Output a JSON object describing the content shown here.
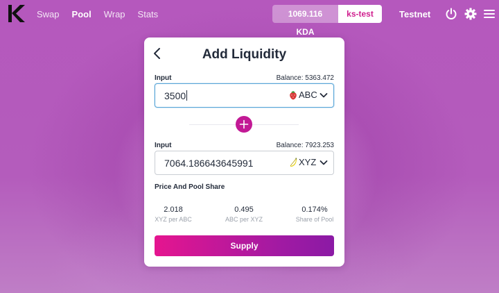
{
  "app": {
    "nav": [
      {
        "label": "Swap"
      },
      {
        "label": "Pool"
      },
      {
        "label": "Wrap"
      },
      {
        "label": "Stats"
      }
    ],
    "active_nav": "Pool",
    "wallet_balance": "1069.116 KDA",
    "account": "ks-test",
    "network": "Testnet"
  },
  "card": {
    "title": "Add Liquidity",
    "input1": {
      "label": "Input",
      "balance": "Balance: 5363.472",
      "value": "3500",
      "token": "ABC",
      "token_icon": "strawberry-icon"
    },
    "input2": {
      "label": "Input",
      "balance": "Balance: 7923.253",
      "value": "7064.186643645991",
      "token": "XYZ",
      "token_icon": "banana-icon"
    },
    "price_section_title": "Price And Pool Share",
    "stats": [
      {
        "value": "2.018",
        "label": "XYZ per ABC"
      },
      {
        "value": "0.495",
        "label": "ABC per XYZ"
      },
      {
        "value": "0.174%",
        "label": "Share of Pool"
      }
    ],
    "supply_label": "Supply"
  },
  "colors": {
    "background": "#b85dbf",
    "accent": "#c21995",
    "account_text": "#d0208f",
    "button_gradient_start": "#e5158f",
    "button_gradient_end": "#8b1aa5"
  }
}
